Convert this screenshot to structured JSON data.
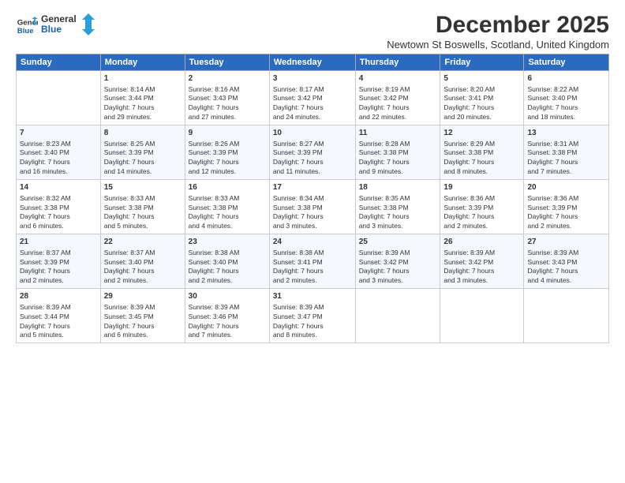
{
  "logo": {
    "line1": "General",
    "line2": "Blue"
  },
  "title": "December 2025",
  "location": "Newtown St Boswells, Scotland, United Kingdom",
  "days": [
    "Sunday",
    "Monday",
    "Tuesday",
    "Wednesday",
    "Thursday",
    "Friday",
    "Saturday"
  ],
  "weeks": [
    [
      {
        "date": "",
        "info": ""
      },
      {
        "date": "1",
        "info": "Sunrise: 8:14 AM\nSunset: 3:44 PM\nDaylight: 7 hours\nand 29 minutes."
      },
      {
        "date": "2",
        "info": "Sunrise: 8:16 AM\nSunset: 3:43 PM\nDaylight: 7 hours\nand 27 minutes."
      },
      {
        "date": "3",
        "info": "Sunrise: 8:17 AM\nSunset: 3:42 PM\nDaylight: 7 hours\nand 24 minutes."
      },
      {
        "date": "4",
        "info": "Sunrise: 8:19 AM\nSunset: 3:42 PM\nDaylight: 7 hours\nand 22 minutes."
      },
      {
        "date": "5",
        "info": "Sunrise: 8:20 AM\nSunset: 3:41 PM\nDaylight: 7 hours\nand 20 minutes."
      },
      {
        "date": "6",
        "info": "Sunrise: 8:22 AM\nSunset: 3:40 PM\nDaylight: 7 hours\nand 18 minutes."
      }
    ],
    [
      {
        "date": "7",
        "info": "Sunrise: 8:23 AM\nSunset: 3:40 PM\nDaylight: 7 hours\nand 16 minutes."
      },
      {
        "date": "8",
        "info": "Sunrise: 8:25 AM\nSunset: 3:39 PM\nDaylight: 7 hours\nand 14 minutes."
      },
      {
        "date": "9",
        "info": "Sunrise: 8:26 AM\nSunset: 3:39 PM\nDaylight: 7 hours\nand 12 minutes."
      },
      {
        "date": "10",
        "info": "Sunrise: 8:27 AM\nSunset: 3:39 PM\nDaylight: 7 hours\nand 11 minutes."
      },
      {
        "date": "11",
        "info": "Sunrise: 8:28 AM\nSunset: 3:38 PM\nDaylight: 7 hours\nand 9 minutes."
      },
      {
        "date": "12",
        "info": "Sunrise: 8:29 AM\nSunset: 3:38 PM\nDaylight: 7 hours\nand 8 minutes."
      },
      {
        "date": "13",
        "info": "Sunrise: 8:31 AM\nSunset: 3:38 PM\nDaylight: 7 hours\nand 7 minutes."
      }
    ],
    [
      {
        "date": "14",
        "info": "Sunrise: 8:32 AM\nSunset: 3:38 PM\nDaylight: 7 hours\nand 6 minutes."
      },
      {
        "date": "15",
        "info": "Sunrise: 8:33 AM\nSunset: 3:38 PM\nDaylight: 7 hours\nand 5 minutes."
      },
      {
        "date": "16",
        "info": "Sunrise: 8:33 AM\nSunset: 3:38 PM\nDaylight: 7 hours\nand 4 minutes."
      },
      {
        "date": "17",
        "info": "Sunrise: 8:34 AM\nSunset: 3:38 PM\nDaylight: 7 hours\nand 3 minutes."
      },
      {
        "date": "18",
        "info": "Sunrise: 8:35 AM\nSunset: 3:38 PM\nDaylight: 7 hours\nand 3 minutes."
      },
      {
        "date": "19",
        "info": "Sunrise: 8:36 AM\nSunset: 3:39 PM\nDaylight: 7 hours\nand 2 minutes."
      },
      {
        "date": "20",
        "info": "Sunrise: 8:36 AM\nSunset: 3:39 PM\nDaylight: 7 hours\nand 2 minutes."
      }
    ],
    [
      {
        "date": "21",
        "info": "Sunrise: 8:37 AM\nSunset: 3:39 PM\nDaylight: 7 hours\nand 2 minutes."
      },
      {
        "date": "22",
        "info": "Sunrise: 8:37 AM\nSunset: 3:40 PM\nDaylight: 7 hours\nand 2 minutes."
      },
      {
        "date": "23",
        "info": "Sunrise: 8:38 AM\nSunset: 3:40 PM\nDaylight: 7 hours\nand 2 minutes."
      },
      {
        "date": "24",
        "info": "Sunrise: 8:38 AM\nSunset: 3:41 PM\nDaylight: 7 hours\nand 2 minutes."
      },
      {
        "date": "25",
        "info": "Sunrise: 8:39 AM\nSunset: 3:42 PM\nDaylight: 7 hours\nand 3 minutes."
      },
      {
        "date": "26",
        "info": "Sunrise: 8:39 AM\nSunset: 3:42 PM\nDaylight: 7 hours\nand 3 minutes."
      },
      {
        "date": "27",
        "info": "Sunrise: 8:39 AM\nSunset: 3:43 PM\nDaylight: 7 hours\nand 4 minutes."
      }
    ],
    [
      {
        "date": "28",
        "info": "Sunrise: 8:39 AM\nSunset: 3:44 PM\nDaylight: 7 hours\nand 5 minutes."
      },
      {
        "date": "29",
        "info": "Sunrise: 8:39 AM\nSunset: 3:45 PM\nDaylight: 7 hours\nand 6 minutes."
      },
      {
        "date": "30",
        "info": "Sunrise: 8:39 AM\nSunset: 3:46 PM\nDaylight: 7 hours\nand 7 minutes."
      },
      {
        "date": "31",
        "info": "Sunrise: 8:39 AM\nSunset: 3:47 PM\nDaylight: 7 hours\nand 8 minutes."
      },
      {
        "date": "",
        "info": ""
      },
      {
        "date": "",
        "info": ""
      },
      {
        "date": "",
        "info": ""
      }
    ]
  ]
}
